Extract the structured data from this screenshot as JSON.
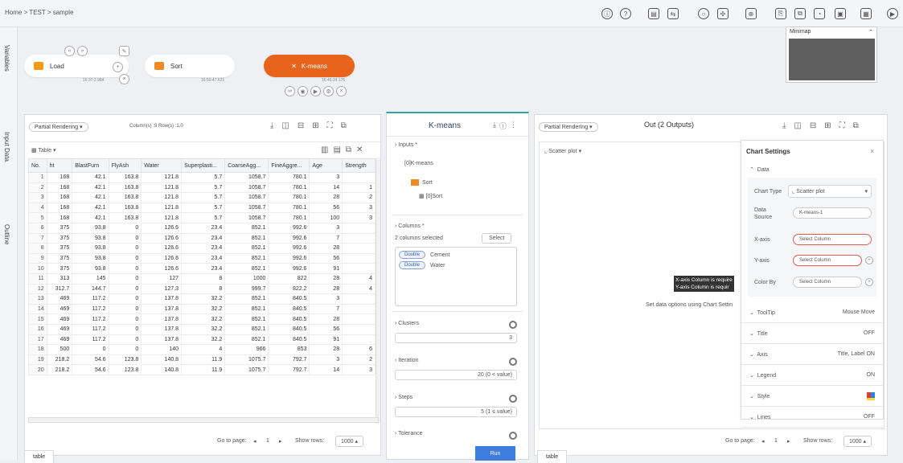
{
  "breadcrumb": "Home > TEST > sample",
  "toolbar_icons": [
    "info-icon",
    "help-icon",
    "save-icon",
    "compare-icon",
    "info-circle-icon",
    "move-icon",
    "zoom-icon",
    "export-icon",
    "copy-icon",
    "history-icon",
    "clipboard-icon",
    "calendar-icon",
    "play-icon"
  ],
  "rail": {
    "variables": "Variables",
    "input_data": "Input Data",
    "outline": "Outline"
  },
  "nodes": {
    "load": {
      "label": "Load",
      "time": "16:37:2.984"
    },
    "sort": {
      "label": "Sort",
      "time": "16:50:47.621"
    },
    "kmeans": {
      "label": "K-means",
      "time": "16:46:14.176"
    }
  },
  "minimap": {
    "title": "Minimap"
  },
  "left_panel": {
    "rendering": "Partial Rendering",
    "info": "Column(s) :9  Row(s) :1,0",
    "table_label": "Table",
    "columns": [
      "No.",
      "ht",
      "BlastFurn",
      "FlyAsh",
      "Water",
      "Superplasti...",
      "CoarseAgg...",
      "FineAggre...",
      "Age",
      "Strength"
    ],
    "rows": [
      [
        "1",
        "168",
        "42.1",
        "163.8",
        "121.8",
        "5.7",
        "1058.7",
        "780.1",
        "3",
        ""
      ],
      [
        "2",
        "168",
        "42.1",
        "163.8",
        "121.8",
        "5.7",
        "1058.7",
        "780.1",
        "14",
        "1"
      ],
      [
        "3",
        "168",
        "42.1",
        "163.8",
        "121.8",
        "5.7",
        "1058.7",
        "780.1",
        "28",
        "2"
      ],
      [
        "4",
        "168",
        "42.1",
        "163.8",
        "121.8",
        "5.7",
        "1058.7",
        "780.1",
        "56",
        "3"
      ],
      [
        "5",
        "168",
        "42.1",
        "163.8",
        "121.8",
        "5.7",
        "1058.7",
        "780.1",
        "100",
        "3"
      ],
      [
        "6",
        "375",
        "93.8",
        "0",
        "126.6",
        "23.4",
        "852.1",
        "992.6",
        "3",
        ""
      ],
      [
        "7",
        "375",
        "93.8",
        "0",
        "126.6",
        "23.4",
        "852.1",
        "992.6",
        "7",
        ""
      ],
      [
        "8",
        "375",
        "93.8",
        "0",
        "126.6",
        "23.4",
        "852.1",
        "992.6",
        "28",
        ""
      ],
      [
        "9",
        "375",
        "93.8",
        "0",
        "126.6",
        "23.4",
        "852.1",
        "992.6",
        "56",
        ""
      ],
      [
        "10",
        "375",
        "93.8",
        "0",
        "126.6",
        "23.4",
        "852.1",
        "992.6",
        "91",
        ""
      ],
      [
        "11",
        "313",
        "145",
        "0",
        "127",
        "8",
        "1000",
        "822",
        "28",
        "4"
      ],
      [
        "12",
        "312.7",
        "144.7",
        "0",
        "127.3",
        "8",
        "999.7",
        "822.2",
        "28",
        "4"
      ],
      [
        "13",
        "469",
        "117.2",
        "0",
        "137.8",
        "32.2",
        "852.1",
        "840.5",
        "3",
        ""
      ],
      [
        "14",
        "469",
        "117.2",
        "0",
        "137.8",
        "32.2",
        "852.1",
        "840.5",
        "7",
        ""
      ],
      [
        "15",
        "469",
        "117.2",
        "0",
        "137.8",
        "32.2",
        "852.1",
        "840.5",
        "28",
        ""
      ],
      [
        "16",
        "469",
        "117.2",
        "0",
        "137.8",
        "32.2",
        "852.1",
        "840.5",
        "56",
        ""
      ],
      [
        "17",
        "469",
        "117.2",
        "0",
        "137.8",
        "32.2",
        "852.1",
        "840.5",
        "91",
        ""
      ],
      [
        "18",
        "500",
        "0",
        "0",
        "140",
        "4",
        "966",
        "853",
        "28",
        "6"
      ],
      [
        "19",
        "218.2",
        "54.6",
        "123.8",
        "140.8",
        "11.9",
        "1075.7",
        "792.7",
        "3",
        "2"
      ],
      [
        "20",
        "218.2",
        "54.6",
        "123.8",
        "140.8",
        "11.9",
        "1075.7",
        "792.7",
        "14",
        "3"
      ]
    ],
    "goto": "Go to page:",
    "page": "1",
    "showrows": "Show rows:",
    "rows_value": "1000",
    "tab": "table"
  },
  "kmeans_panel": {
    "title": "K-means",
    "inputs": "Inputs",
    "input_ref": "[0]K-means",
    "sort_label": "Sort",
    "sort_ref": "[0]Sort",
    "columns": "Columns",
    "columns_selected": "2 columns selected",
    "select_btn": "Select",
    "col_items": [
      {
        "type": "Double",
        "name": "Cement"
      },
      {
        "type": "Double",
        "name": "Water"
      }
    ],
    "clusters": "Clusters",
    "clusters_val": "3",
    "iteration": "Iteration",
    "iteration_val": "20 (0 < value)",
    "steps": "Steps",
    "steps_val": "5 (1 ≤ value)",
    "tolerance": "Tolerance",
    "run": "Run"
  },
  "out_panel": {
    "rendering": "Partial Rendering",
    "title": "Out (2 Outputs)",
    "chart_type_dd": "Scatter plot",
    "warn1": "X-axis Column is require",
    "warn2": "Y-axis Column is requir",
    "hint": "Set data options using Chart Settin",
    "goto": "Go to page:",
    "page": "1",
    "showrows": "Show rows:",
    "rows_value": "1000",
    "tab": "table"
  },
  "chart_settings": {
    "title": "Chart Settings",
    "data": "Data",
    "chart_type_label": "Chart Type",
    "chart_type_value": "Scatter plot",
    "data_source_label": "Data Source",
    "data_source_value": "K-means-1",
    "xaxis_label": "X-axis",
    "xaxis_ph": "Select Column",
    "yaxis_label": "Y-axis",
    "yaxis_ph": "Select Column",
    "colorby_label": "Color By",
    "colorby_ph": "Select Column",
    "rows": [
      {
        "label": "ToolTip",
        "value": "Mouse Move"
      },
      {
        "label": "Title",
        "value": "OFF"
      },
      {
        "label": "Axis",
        "value": "Title, Label ON"
      },
      {
        "label": "Legend",
        "value": "ON"
      },
      {
        "label": "Style",
        "value": ""
      },
      {
        "label": "Lines",
        "value": "OFF"
      }
    ]
  },
  "colors": {
    "accent": "#e8641c",
    "teal": "#2fa6a0",
    "run": "#3d7de0",
    "error": "#e15a5a"
  }
}
